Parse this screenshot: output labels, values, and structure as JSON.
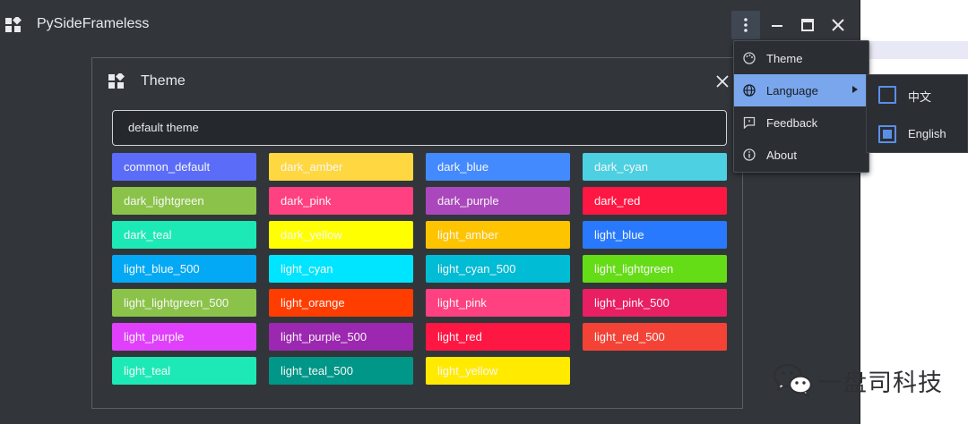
{
  "window": {
    "title": "PySideFrameless"
  },
  "dialog": {
    "title": "Theme",
    "current_theme": "default theme",
    "themes": [
      {
        "label": "common_default",
        "color": "#5b6df8"
      },
      {
        "label": "dark_amber",
        "color": "#ffd740"
      },
      {
        "label": "dark_blue",
        "color": "#448aff"
      },
      {
        "label": "dark_cyan",
        "color": "#4dd0e1"
      },
      {
        "label": "dark_lightgreen",
        "color": "#8bc34a"
      },
      {
        "label": "dark_pink",
        "color": "#ff4081"
      },
      {
        "label": "dark_purple",
        "color": "#ab47bc"
      },
      {
        "label": "dark_red",
        "color": "#ff1744"
      },
      {
        "label": "dark_teal",
        "color": "#1de9b6"
      },
      {
        "label": "dark_yellow",
        "color": "#ffff00"
      },
      {
        "label": "light_amber",
        "color": "#ffc400"
      },
      {
        "label": "light_blue",
        "color": "#2979ff"
      },
      {
        "label": "light_blue_500",
        "color": "#03a9f4"
      },
      {
        "label": "light_cyan",
        "color": "#00e5ff"
      },
      {
        "label": "light_cyan_500",
        "color": "#00bcd4"
      },
      {
        "label": "light_lightgreen",
        "color": "#64dd17"
      },
      {
        "label": "light_lightgreen_500",
        "color": "#8bc34a"
      },
      {
        "label": "light_orange",
        "color": "#ff3d00"
      },
      {
        "label": "light_pink",
        "color": "#ff4081"
      },
      {
        "label": "light_pink_500",
        "color": "#e91e63"
      },
      {
        "label": "light_purple",
        "color": "#e040fb"
      },
      {
        "label": "light_purple_500",
        "color": "#9c27b0"
      },
      {
        "label": "light_red",
        "color": "#ff1744"
      },
      {
        "label": "light_red_500",
        "color": "#f44336"
      },
      {
        "label": "light_teal",
        "color": "#1de9b6"
      },
      {
        "label": "light_teal_500",
        "color": "#009688"
      },
      {
        "label": "light_yellow",
        "color": "#ffea00"
      }
    ]
  },
  "menu": {
    "items": [
      {
        "label": "Theme",
        "icon": "palette-icon"
      },
      {
        "label": "Language",
        "icon": "globe-icon",
        "active": true,
        "has_submenu": true
      },
      {
        "label": "Feedback",
        "icon": "feedback-icon"
      },
      {
        "label": "About",
        "icon": "info-icon"
      }
    ]
  },
  "language_submenu": {
    "options": [
      {
        "label": "中文",
        "checked": false
      },
      {
        "label": "English",
        "checked": true
      }
    ]
  },
  "watermark": {
    "text": "一盘司科技"
  },
  "colors": {
    "window_bg": "#32363a",
    "menu_active": "#79a6ec",
    "checkbox_accent": "#5a8fe8"
  }
}
